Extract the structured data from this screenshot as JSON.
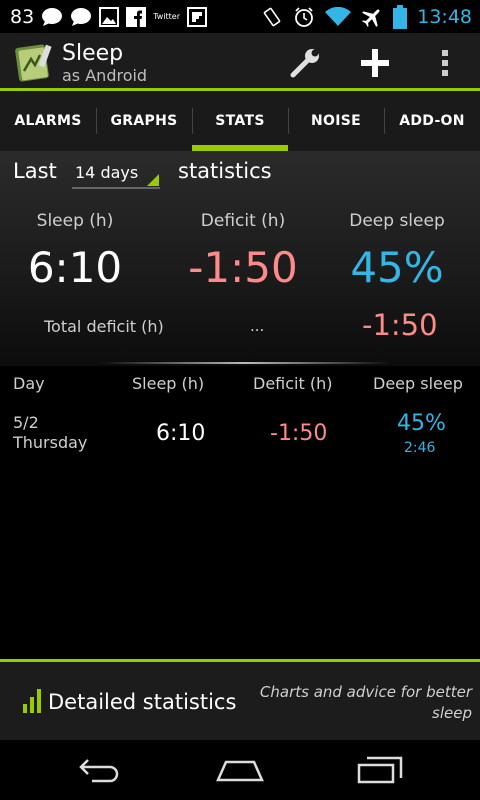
{
  "status_bar": {
    "notification_count": "83",
    "twitter_label": "Twitter",
    "time": "13:48",
    "icons": [
      "chat-icon",
      "chat-icon",
      "image-icon",
      "facebook-icon",
      "twitter-icon",
      "flipboard-icon",
      "rotate-icon",
      "alarm-icon",
      "wifi-icon",
      "airplane-icon",
      "battery-icon"
    ],
    "time_color": "#33b5e5"
  },
  "action_bar": {
    "title": "Sleep",
    "subtitle": "as Android",
    "actions": [
      "wrench-icon",
      "plus-icon",
      "overflow-menu-icon"
    ]
  },
  "tabs": [
    {
      "label": "ALARMS",
      "active": false
    },
    {
      "label": "GRAPHS",
      "active": false
    },
    {
      "label": "STATS",
      "active": true
    },
    {
      "label": "NOISE",
      "active": false
    },
    {
      "label": "ADD-ON",
      "active": false
    }
  ],
  "stats": {
    "prefix": "Last",
    "period": "14 days",
    "suffix": "statistics",
    "columns": [
      {
        "label": "Sleep (h)",
        "value": "6:10"
      },
      {
        "label": "Deficit (h)",
        "value": "-1:50"
      },
      {
        "label": "Deep sleep",
        "value": "45%"
      }
    ],
    "total_label": "Total deficit (h)",
    "total_mid": "...",
    "total_value": "-1:50"
  },
  "table": {
    "headers": [
      "Day",
      "Sleep (h)",
      "Deficit (h)",
      "Deep sleep"
    ],
    "rows": [
      {
        "date": "5/2",
        "weekday": "Thursday",
        "sleep": "6:10",
        "deficit": "-1:50",
        "deep_pct": "45%",
        "deep_time": "2:46"
      }
    ]
  },
  "detailed": {
    "title": "Detailed statistics",
    "subtitle": "Charts and advice for better sleep"
  },
  "colors": {
    "accent": "#99cc00",
    "deficit": "#ff8a8a",
    "deep": "#33b5e5"
  }
}
